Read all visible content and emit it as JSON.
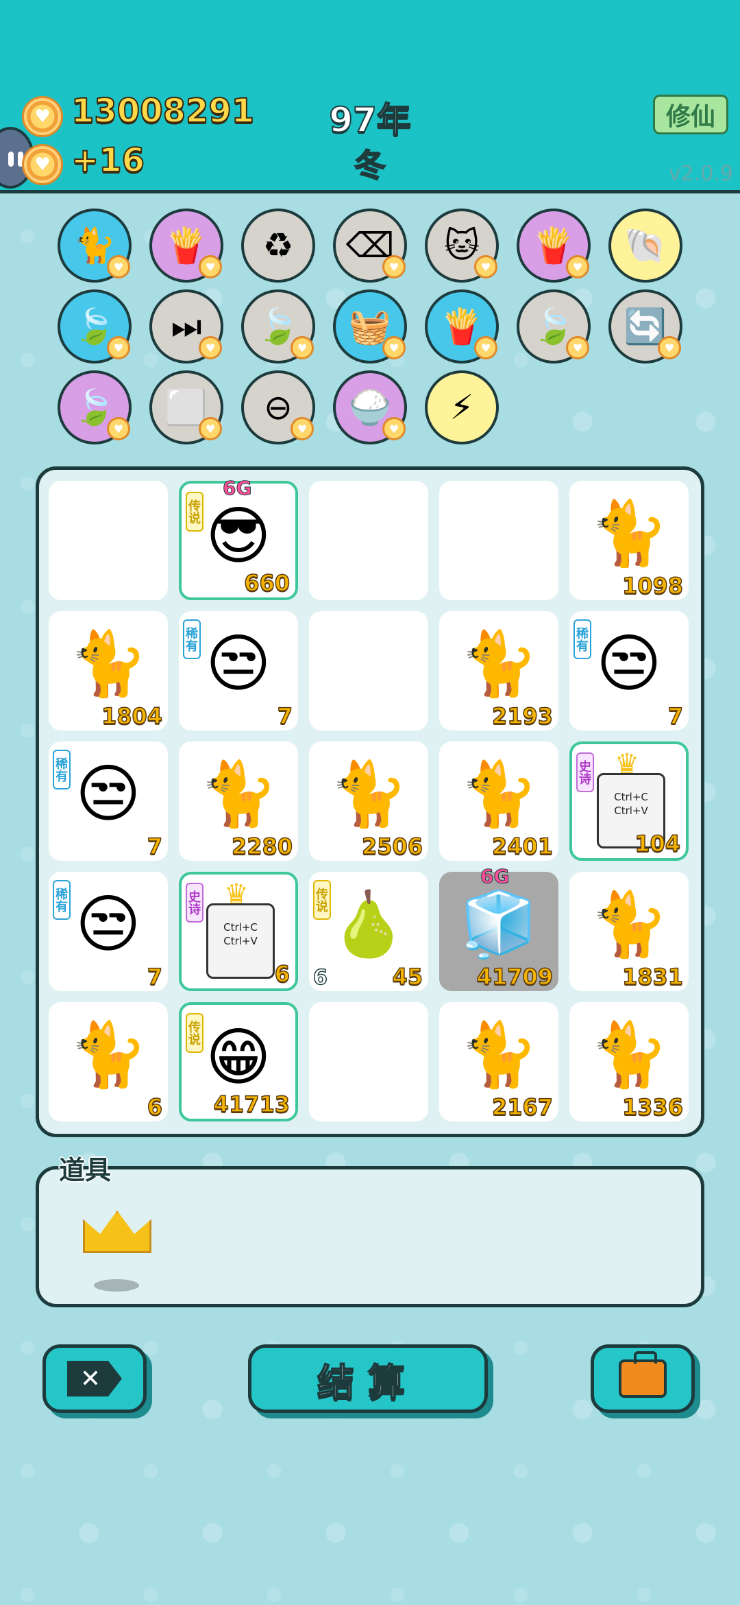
{
  "header": {
    "coins": "13008291",
    "income": "+16",
    "year": "97年",
    "season": "冬",
    "cultivate_label": "修仙",
    "version": "v2.0.9"
  },
  "skills": [
    {
      "name": "cat-silhouette",
      "glyph": "🐈",
      "color": "blue",
      "badge": true
    },
    {
      "name": "fries",
      "glyph": "🍟",
      "color": "purple",
      "badge": true
    },
    {
      "name": "recycle",
      "glyph": "♻",
      "color": "gray",
      "badge": false
    },
    {
      "name": "delete-tag",
      "glyph": "⌫",
      "color": "gray",
      "badge": true
    },
    {
      "name": "cat-pair",
      "glyph": "🐱",
      "color": "gray",
      "badge": true
    },
    {
      "name": "fries",
      "glyph": "🍟",
      "color": "purple",
      "badge": true
    },
    {
      "name": "shell",
      "glyph": "🐚",
      "color": "yellow",
      "badge": false
    },
    {
      "name": "leaf",
      "glyph": "🍃",
      "color": "blue",
      "badge": true
    },
    {
      "name": "skip",
      "glyph": "⏭",
      "color": "gray",
      "badge": true
    },
    {
      "name": "leaf",
      "glyph": "🍃",
      "color": "gray",
      "badge": true
    },
    {
      "name": "fruit-basket",
      "glyph": "🧺",
      "color": "blue",
      "badge": true
    },
    {
      "name": "fries",
      "glyph": "🍟",
      "color": "blue",
      "badge": true
    },
    {
      "name": "leaf",
      "glyph": "🍃",
      "color": "gray",
      "badge": true
    },
    {
      "name": "refresh",
      "glyph": "🔄",
      "color": "gray",
      "badge": true
    },
    {
      "name": "leaf",
      "glyph": "🍃",
      "color": "purple",
      "badge": true
    },
    {
      "name": "cubes",
      "glyph": "⬜",
      "color": "gray",
      "badge": true
    },
    {
      "name": "minus",
      "glyph": "⊖",
      "color": "gray",
      "badge": true
    },
    {
      "name": "rice-bowl",
      "glyph": "🍚",
      "color": "purple",
      "badge": true
    },
    {
      "name": "lightning",
      "glyph": "⚡",
      "color": "yellow",
      "badge": false
    }
  ],
  "board": [
    {
      "item": "",
      "count": "",
      "tag": "",
      "style": ""
    },
    {
      "item": "crowned-man",
      "glyph": "😎",
      "count": "660",
      "tag": "传说",
      "tag_type": "legend",
      "style": "gold",
      "sixg": "6G"
    },
    {
      "item": "",
      "count": "",
      "tag": "",
      "style": ""
    },
    {
      "item": "",
      "count": "",
      "tag": "",
      "style": ""
    },
    {
      "item": "cat",
      "glyph": "🐈",
      "count": "1098",
      "tag": "",
      "style": ""
    },
    {
      "item": "cat",
      "glyph": "🐈",
      "count": "1804",
      "tag": "",
      "style": ""
    },
    {
      "item": "bucket-hat-man",
      "glyph": "😒",
      "count": "7",
      "tag": "稀有",
      "tag_type": "rare",
      "style": ""
    },
    {
      "item": "",
      "count": "",
      "tag": "",
      "style": ""
    },
    {
      "item": "cat",
      "glyph": "🐈",
      "count": "2193",
      "tag": "",
      "style": ""
    },
    {
      "item": "bucket-hat-man",
      "glyph": "😒",
      "count": "7",
      "tag": "稀有",
      "tag_type": "rare",
      "style": ""
    },
    {
      "item": "bucket-hat-man",
      "glyph": "😒",
      "count": "7",
      "tag": "稀有",
      "tag_type": "rare",
      "style": ""
    },
    {
      "item": "cat",
      "glyph": "🐈",
      "count": "2280",
      "tag": "",
      "style": ""
    },
    {
      "item": "cat",
      "glyph": "🐈",
      "count": "2506",
      "tag": "",
      "style": ""
    },
    {
      "item": "cat",
      "glyph": "🐈",
      "count": "2401",
      "tag": "",
      "style": ""
    },
    {
      "item": "copy-paste",
      "glyph": "",
      "count": "104",
      "tag": "史诗",
      "tag_type": "epic",
      "style": "gold",
      "copy": true
    },
    {
      "item": "bucket-hat-man",
      "glyph": "😒",
      "count": "7",
      "tag": "稀有",
      "tag_type": "rare",
      "style": ""
    },
    {
      "item": "copy-paste",
      "glyph": "",
      "count": "6",
      "tag": "史诗",
      "tag_type": "epic",
      "style": "gold",
      "copy": true
    },
    {
      "item": "pear",
      "glyph": "🍐",
      "count": "45",
      "tag": "传说",
      "tag_type": "legend",
      "style": "",
      "left_num": "6"
    },
    {
      "item": "fridge",
      "glyph": "🧊",
      "count": "41709",
      "tag": "",
      "style": "grey",
      "sixg": "6G"
    },
    {
      "item": "cat",
      "glyph": "🐈",
      "count": "1831",
      "tag": "",
      "style": ""
    },
    {
      "item": "cat",
      "glyph": "🐈",
      "count": "6",
      "tag": "",
      "style": ""
    },
    {
      "item": "grinning-man",
      "glyph": "😁",
      "count": "41713",
      "tag": "传说",
      "tag_type": "legend",
      "style": "gold"
    },
    {
      "item": "",
      "count": "",
      "tag": "",
      "style": ""
    },
    {
      "item": "cat",
      "glyph": "🐈",
      "count": "2167",
      "tag": "",
      "style": ""
    },
    {
      "item": "cat",
      "glyph": "🐈",
      "count": "1336",
      "tag": "",
      "style": ""
    }
  ],
  "copy_text": [
    "Ctrl+C",
    "Ctrl+V"
  ],
  "props": {
    "label": "道具",
    "items": [
      "crown"
    ]
  },
  "buttons": {
    "discard_icon": "✕",
    "settle_label": "结算",
    "bag_icon": "briefcase-icon"
  }
}
